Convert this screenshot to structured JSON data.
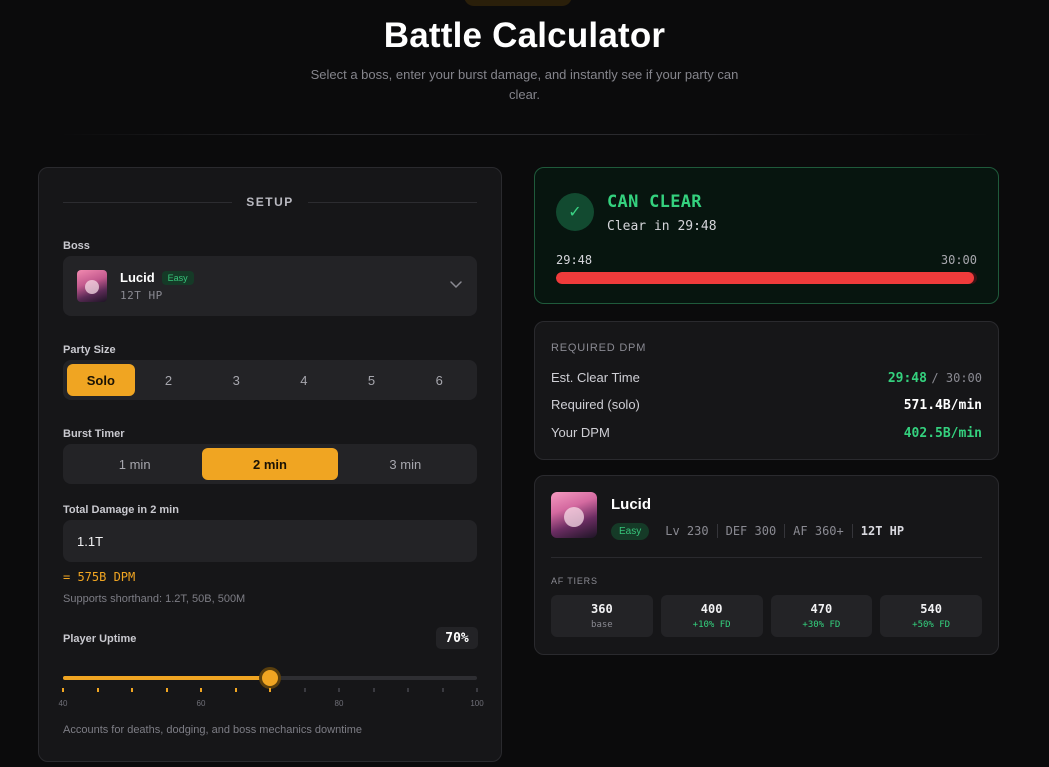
{
  "header": {
    "title": "Battle Calculator",
    "subtitle": "Select a boss, enter your burst damage, and instantly see if your party can clear."
  },
  "setup": {
    "heading": "SETUP",
    "boss": {
      "label": "Boss",
      "name": "Lucid",
      "difficulty": "Easy",
      "hp": "12T HP"
    },
    "party_size": {
      "label": "Party Size",
      "options": [
        "Solo",
        "2",
        "3",
        "4",
        "5",
        "6"
      ],
      "selected": "Solo"
    },
    "burst_timer": {
      "label": "Burst Timer",
      "options": [
        "1 min",
        "2 min",
        "3 min"
      ],
      "selected": "2 min"
    },
    "total_damage": {
      "label": "Total Damage in 2 min",
      "value": "1.1T",
      "dpm_display": "= 575B DPM",
      "hint": "Supports shorthand: 1.2T, 50B, 500M"
    },
    "uptime": {
      "label": "Player Uptime",
      "value_text": "70%",
      "value": 70,
      "min": 40,
      "max": 100,
      "tick_labels": [
        "40",
        "60",
        "80",
        "100"
      ],
      "hint": "Accounts for deaths, dodging, and boss mechanics downtime"
    }
  },
  "result": {
    "status": "CAN CLEAR",
    "check_icon": "✓",
    "subtitle": "Clear in 29:48",
    "time_left": "29:48",
    "time_right": "30:00",
    "progress": 0.993,
    "colors": {
      "success": "#34d17e",
      "bar": "#ef3b3b"
    }
  },
  "dpm": {
    "heading": "REQUIRED DPM",
    "rows": {
      "clear_time_label": "Est. Clear Time",
      "clear_time_value": "29:48",
      "clear_time_limit": "/ 30:00",
      "required_label": "Required (solo)",
      "required_value": "571.4B/min",
      "yours_label": "Your DPM",
      "yours_value": "402.5B/min"
    }
  },
  "boss_card": {
    "name": "Lucid",
    "difficulty": "Easy",
    "level": "Lv 230",
    "def": "DEF 300",
    "af": "AF 360+",
    "hp": "12T HP",
    "af_heading": "AF TIERS",
    "tiers": [
      {
        "value": "360",
        "bonus": "base"
      },
      {
        "value": "400",
        "bonus": "+10% FD"
      },
      {
        "value": "470",
        "bonus": "+30% FD"
      },
      {
        "value": "540",
        "bonus": "+50% FD"
      }
    ]
  },
  "colors": {
    "accent": "#f0a522",
    "success": "#34d17e",
    "danger": "#ef3b3b",
    "panel": "#161618"
  }
}
